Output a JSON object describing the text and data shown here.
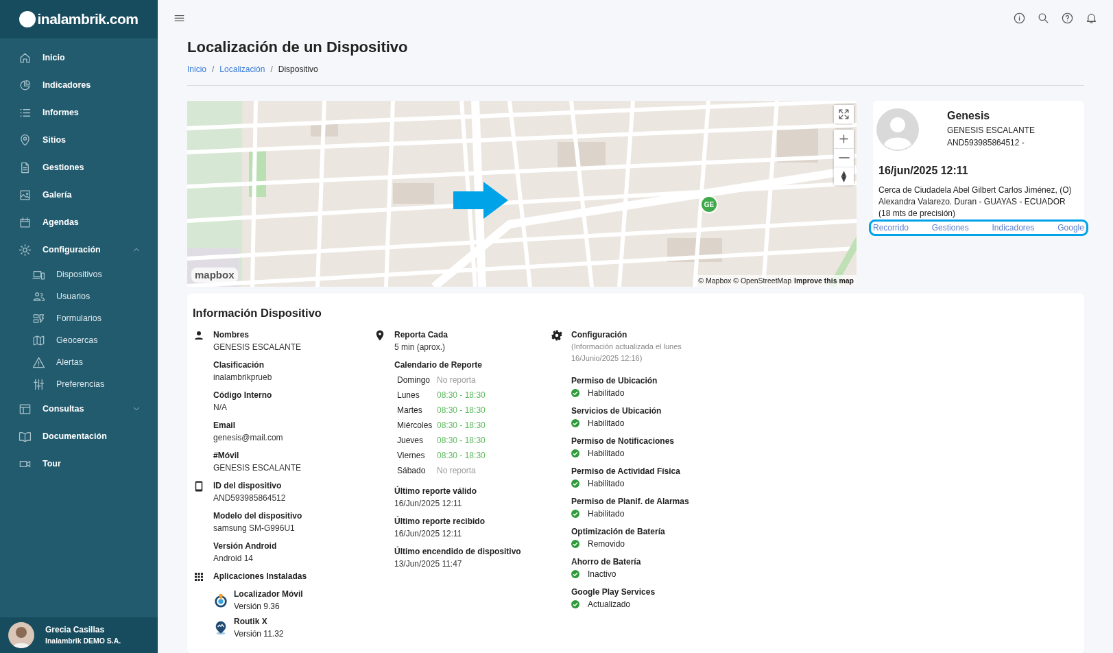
{
  "brand": {
    "logo_text": "inalambrik.com"
  },
  "sidebar": {
    "items": [
      {
        "label": "Inicio"
      },
      {
        "label": "Indicadores"
      },
      {
        "label": "Informes"
      },
      {
        "label": "Sitios"
      },
      {
        "label": "Gestiones"
      },
      {
        "label": "Galería"
      },
      {
        "label": "Agendas"
      },
      {
        "label": "Configuración",
        "expanded": true,
        "children": [
          {
            "label": "Dispositivos"
          },
          {
            "label": "Usuarios"
          },
          {
            "label": "Formularios"
          },
          {
            "label": "Geocercas"
          },
          {
            "label": "Alertas"
          },
          {
            "label": "Preferencias"
          }
        ]
      },
      {
        "label": "Consultas",
        "expanded": false
      },
      {
        "label": "Documentación"
      },
      {
        "label": "Tour"
      }
    ]
  },
  "user": {
    "name": "Grecia Casillas",
    "company": "Inalambrik DEMO S.A."
  },
  "page": {
    "title": "Localización de un Dispositivo",
    "breadcrumb_separator": "/",
    "breadcrumb": [
      {
        "label": "Inicio",
        "link": true
      },
      {
        "label": "Localización",
        "link": true
      },
      {
        "label": "Dispositivo",
        "link": false
      }
    ]
  },
  "map": {
    "kind": "picture",
    "marker": "GE",
    "logo": "mapbox",
    "attribution": "© Mapbox © OpenStreetMap",
    "improve_link": "Improve this map"
  },
  "device_card": {
    "name": "Genesis",
    "owner": "GENESIS ESCALANTE",
    "id_line": "AND593985864512 -",
    "datetime": "16/jun/2025 12:11",
    "address": "Cerca de Ciudadela Abel Gilbert Carlos Jiménez, (O) Alexandra Valarezo. Duran - GUAYAS - ECUADOR (18 mts de precisión)",
    "links": [
      "Recorrido",
      "Gestiones",
      "Indicadores",
      "Google"
    ]
  },
  "info": {
    "title": "Información Dispositivo",
    "person_fields": [
      {
        "label": "Nombres",
        "value": "GENESIS ESCALANTE"
      },
      {
        "label": "Clasificación",
        "value": "inalambrikprueb"
      },
      {
        "label": "Código Interno",
        "value": "N/A"
      },
      {
        "label": "Email",
        "value": "genesis@mail.com"
      },
      {
        "label": "#Móvil",
        "value": "GENESIS ESCALANTE"
      }
    ],
    "device_fields": [
      {
        "label": "ID del dispositivo",
        "value": "AND593985864512"
      },
      {
        "label": "Modelo del dispositivo",
        "value": "samsung SM-G996U1"
      },
      {
        "label": "Versión Android",
        "value": "Android 14"
      }
    ],
    "apps": {
      "title": "Aplicaciones Instaladas",
      "items": [
        {
          "name": "Localizador Móvil",
          "version": "Versión 9.36"
        },
        {
          "name": "Routik X",
          "version": "Versión 11.32"
        }
      ]
    },
    "report_every": {
      "label": "Reporta Cada",
      "value": "5 min (aprox.)"
    },
    "schedule": {
      "title": "Calendario de Reporte",
      "days": [
        {
          "day": "Domingo",
          "hours": "No reporta",
          "active": false
        },
        {
          "day": "Lunes",
          "hours": "08:30 - 18:30",
          "active": true
        },
        {
          "day": "Martes",
          "hours": "08:30 - 18:30",
          "active": true
        },
        {
          "day": "Miércoles",
          "hours": "08:30 - 18:30",
          "active": true
        },
        {
          "day": "Jueves",
          "hours": "08:30 - 18:30",
          "active": true
        },
        {
          "day": "Viernes",
          "hours": "08:30 - 18:30",
          "active": true
        },
        {
          "day": "Sábado",
          "hours": "No reporta",
          "active": false
        }
      ]
    },
    "report_fields": [
      {
        "label": "Último reporte válido",
        "value": "16/Jun/2025 12:11"
      },
      {
        "label": "Último reporte recibido",
        "value": "16/Jun/2025 12:11"
      },
      {
        "label": "Último encendido de dispositivo",
        "value": "13/Jun/2025 11:47"
      }
    ],
    "config": {
      "title": "Configuración",
      "note": "(Información actualizada el lunes 16/Junio/2025 12:16)",
      "items": [
        {
          "label": "Permiso de Ubicación",
          "status": "Habilitado"
        },
        {
          "label": "Servicios de Ubicación",
          "status": "Habilitado"
        },
        {
          "label": "Permiso de Notificaciones",
          "status": "Habilitado"
        },
        {
          "label": "Permiso de Actividad Física",
          "status": "Habilitado"
        },
        {
          "label": "Permiso de Planif. de Alarmas",
          "status": "Habilitado"
        },
        {
          "label": "Optimización de Batería",
          "status": "Removido"
        },
        {
          "label": "Ahorro de Batería",
          "status": "Inactivo"
        },
        {
          "label": "Google Play Services",
          "status": "Actualizado"
        }
      ]
    }
  }
}
